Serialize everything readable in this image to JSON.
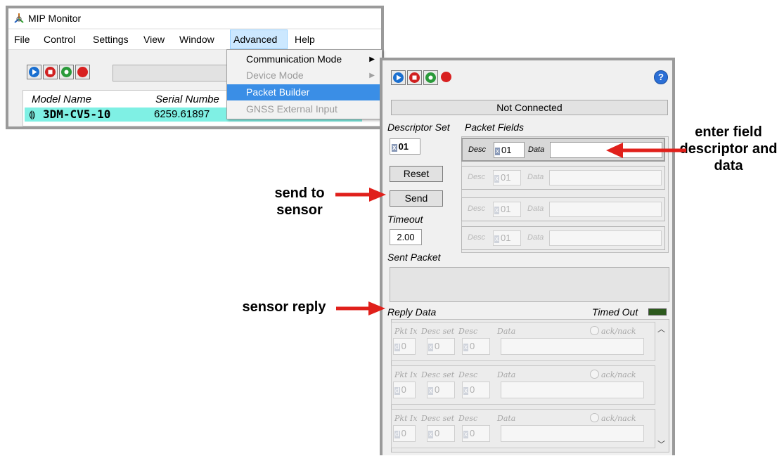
{
  "main_window": {
    "title": "MIP Monitor",
    "menu": [
      "File",
      "Control",
      "Settings",
      "View",
      "Window",
      "Advanced",
      "Help"
    ],
    "device_list": {
      "headers": [
        "Model Name",
        "Serial Numbe"
      ],
      "rows": [
        {
          "icon": "sensor-icon",
          "model": "3DM-CV5-10",
          "serial": "6259.61897"
        }
      ]
    },
    "advanced_menu": [
      {
        "label": "Communication Mode",
        "arrow": "▶",
        "enabled": true
      },
      {
        "label": "Device Mode",
        "arrow": "▶",
        "enabled": false
      },
      {
        "label": "Packet Builder",
        "arrow": "",
        "enabled": true,
        "highlighted": true
      },
      {
        "label": "GNSS External Input",
        "arrow": "",
        "enabled": false
      }
    ],
    "toolbar_icons": [
      "play-icon",
      "stop-icon",
      "record-icon",
      "record-red-icon"
    ]
  },
  "packet_builder": {
    "status": "Not Connected",
    "help_icon": "?",
    "descriptor_set_label": "Descriptor Set",
    "packet_fields_label": "Packet Fields",
    "descriptor_set_value": "01",
    "hex_prefix": "x",
    "reset_label": "Reset",
    "send_label": "Send",
    "timeout_label": "Timeout",
    "timeout_value": "2.00",
    "packet_fields": [
      {
        "desc_label": "Desc",
        "desc_value": "01",
        "data_label": "Data",
        "data_value": "",
        "active": true
      },
      {
        "desc_label": "Desc",
        "desc_value": "01",
        "data_label": "Data",
        "data_value": "",
        "active": false
      },
      {
        "desc_label": "Desc",
        "desc_value": "01",
        "data_label": "Data",
        "data_value": "",
        "active": false
      },
      {
        "desc_label": "Desc",
        "desc_value": "01",
        "data_label": "Data",
        "data_value": "",
        "active": false
      }
    ],
    "sent_packet_label": "Sent Packet",
    "sent_packet_value": "",
    "reply_data_label": "Reply Data",
    "timed_out_label": "Timed Out",
    "reply_rows": [
      {
        "pkt_ix_label": "Pkt Ix",
        "desc_set_label": "Desc set",
        "desc_label": "Desc",
        "data_label": "Data",
        "ack_label": "ack/nack",
        "pkt_ix": "0",
        "pkt_prefix": "d",
        "desc_set": "0",
        "desc": "0"
      },
      {
        "pkt_ix_label": "Pkt Ix",
        "desc_set_label": "Desc set",
        "desc_label": "Desc",
        "data_label": "Data",
        "ack_label": "ack/nack",
        "pkt_ix": "0",
        "pkt_prefix": "d",
        "desc_set": "0",
        "desc": "0"
      },
      {
        "pkt_ix_label": "Pkt Ix",
        "desc_set_label": "Desc set",
        "desc_label": "Desc",
        "data_label": "Data",
        "ack_label": "ack/nack",
        "pkt_ix": "0",
        "pkt_prefix": "d",
        "desc_set": "0",
        "desc": "0"
      }
    ]
  },
  "annotations": {
    "enter_field": "enter field descriptor and data",
    "send_to_sensor": "send to sensor",
    "sensor_reply": "sensor reply"
  },
  "colors": {
    "arrow": "#e0201b",
    "device_row": "#7ff0e4",
    "menu_highlight": "#3a8ee6",
    "led_off": "#2d5a1e"
  }
}
